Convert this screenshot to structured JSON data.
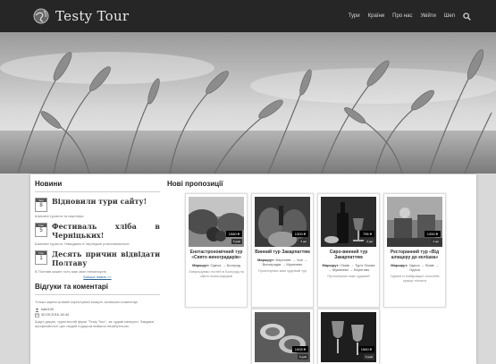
{
  "header": {
    "logo_text": "Testy Tour",
    "nav": [
      "Тури",
      "Країни",
      "Про нас",
      "Увійти",
      "Шеп"
    ]
  },
  "colors": {
    "topbar": "#262626",
    "link": "#2a6496"
  },
  "sidebar": {
    "news_title": "Новини",
    "news": [
      {
        "month": "Sep",
        "day": "8",
        "title": "Відновили тури сайту!",
        "text": "Шановні туристи та партнери"
      },
      {
        "month": "Trav",
        "day": "5",
        "title": "Фестиваль хліба в Черніцьких!",
        "text": "Шановні туристи. Наводимо в Черніцьке розпочинається"
      },
      {
        "month": "Trav",
        "day": "1",
        "title": "Десять причин відвідати Полтаву",
        "text": "В Полтаві кожен гість має своє неповторне"
      }
    ],
    "more_link": "Більше новин >>",
    "comments_title": "Відгуки та коментарі",
    "comment_note": "Тільки зареєстровані користувачі можуть залишати коментарі",
    "comment_author": "kate100",
    "comment_date": "30.09.2016 18:44",
    "comment_text": "Щиро дякую, туристичній фірмі \"Testy Tour\", за чудові канікули. Завдяки професійності цих людей подорож вийшла незабутньою."
  },
  "main": {
    "title": "Нові пропозиції",
    "cards": [
      {
        "title": "Енотастрономічний тур «Свято виноградарів»",
        "price": "1580 ₴",
        "days": "5 днів",
        "route_label": "Маршрут:",
        "route": "Одеса → Болград",
        "desc": "Запрошуємо гостей в Болград на свято виноградарів"
      },
      {
        "title": "Винний тур Закарпаттям",
        "price": "1300 ₴",
        "days": "3 дні",
        "route_label": "Маршрут:",
        "route": "Берегове → Чоп → Виноградів → Мукачево",
        "desc": "Пропонуємо вам чудовий тур"
      },
      {
        "title": "Сиро-винний тур Закарпаттям",
        "price": "795 ₴",
        "days": "3 дні",
        "route_label": "Маршрут:",
        "route": "Львів → Тур'я Пасіка → Мукачево → Берегово",
        "desc": "Пропонуємо вам чудовий"
      },
      {
        "title": "Ресторанний тур «Від шпацеру до келішка»",
        "price": "1350 ₴",
        "days": "4 дні",
        "route_label": "Маршрут:",
        "route": "Одеса → Львів → Одеса",
        "desc": "Одним із найкращих способів краще пізнати"
      },
      {
        "title": "",
        "price": "1595 ₴",
        "days": "5 днів",
        "route_label": "",
        "route": "",
        "desc": ""
      },
      {
        "title": "",
        "price": "1560 ₴",
        "days": "5 днів",
        "route_label": "",
        "route": "",
        "desc": ""
      }
    ]
  }
}
